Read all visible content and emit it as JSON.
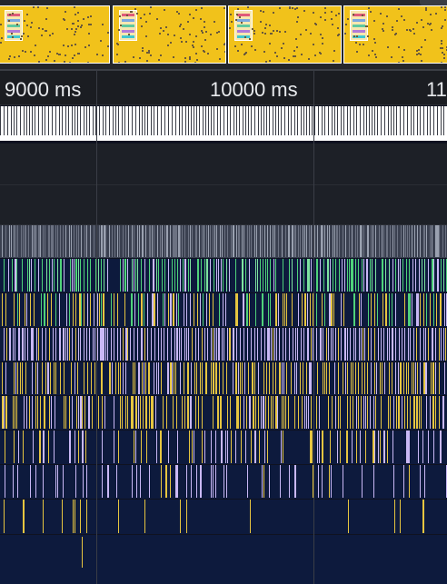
{
  "ruler": {
    "labels": [
      "9000 ms",
      "10000 ms",
      "11"
    ]
  },
  "filmstrip": {
    "frame_count": 4,
    "frame_color": "#f1c21b"
  },
  "tracks": [
    {
      "name": "frames-track",
      "color": "#d8dde6",
      "density": 0.75,
      "style": "ticks"
    },
    {
      "name": "gray-track",
      "color": "#8c93a3",
      "density": 0.92,
      "style": "gray"
    },
    {
      "name": "green-track",
      "color": "#4fd27a",
      "density": 0.85,
      "style": "mixed-green"
    },
    {
      "name": "green-yellow-track",
      "color": "#c6d64a",
      "density": 0.8,
      "style": "mixed-gy"
    },
    {
      "name": "lavender-track",
      "color": "#c9b8f5",
      "density": 0.9,
      "style": "lav"
    },
    {
      "name": "yellow-track-1",
      "color": "#e6c540",
      "density": 0.85,
      "style": "yel"
    },
    {
      "name": "yellow-track-2",
      "color": "#e6c540",
      "density": 0.8,
      "style": "yel"
    },
    {
      "name": "mixed-track",
      "color": "#c9b8f5",
      "density": 0.6,
      "style": "mix"
    },
    {
      "name": "lavender-sparse-track",
      "color": "#c9b8f5",
      "density": 0.45,
      "style": "lavsparse"
    },
    {
      "name": "sparse-track",
      "color": "#e6c540",
      "density": 0.25,
      "style": "sparse"
    },
    {
      "name": "very-sparse-track",
      "color": "#e6c540",
      "density": 0.06,
      "style": "vsparse"
    }
  ],
  "colors": {
    "background": "#0f1220",
    "track_bg": "#0d1a3d",
    "yellow": "#e6c540",
    "green": "#4fd27a",
    "lavender": "#c9b8f5",
    "gray": "#8c93a3"
  }
}
